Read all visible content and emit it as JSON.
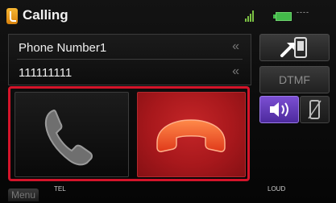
{
  "header": {
    "title": "Calling",
    "status_text": "---- "
  },
  "call_info": {
    "name": "Phone Number1",
    "number": "111111111"
  },
  "side": {
    "dtmf_label": "DTMF"
  },
  "bottom": {
    "menu_label": "Menu",
    "source_label": "TEL",
    "loud_label": "LOUD"
  },
  "colors": {
    "frame_red": "#d4142a",
    "decline_red": "#b01a1e",
    "handset_orange": "#f04a1e",
    "speaker_purple": "#6a3fc4"
  }
}
